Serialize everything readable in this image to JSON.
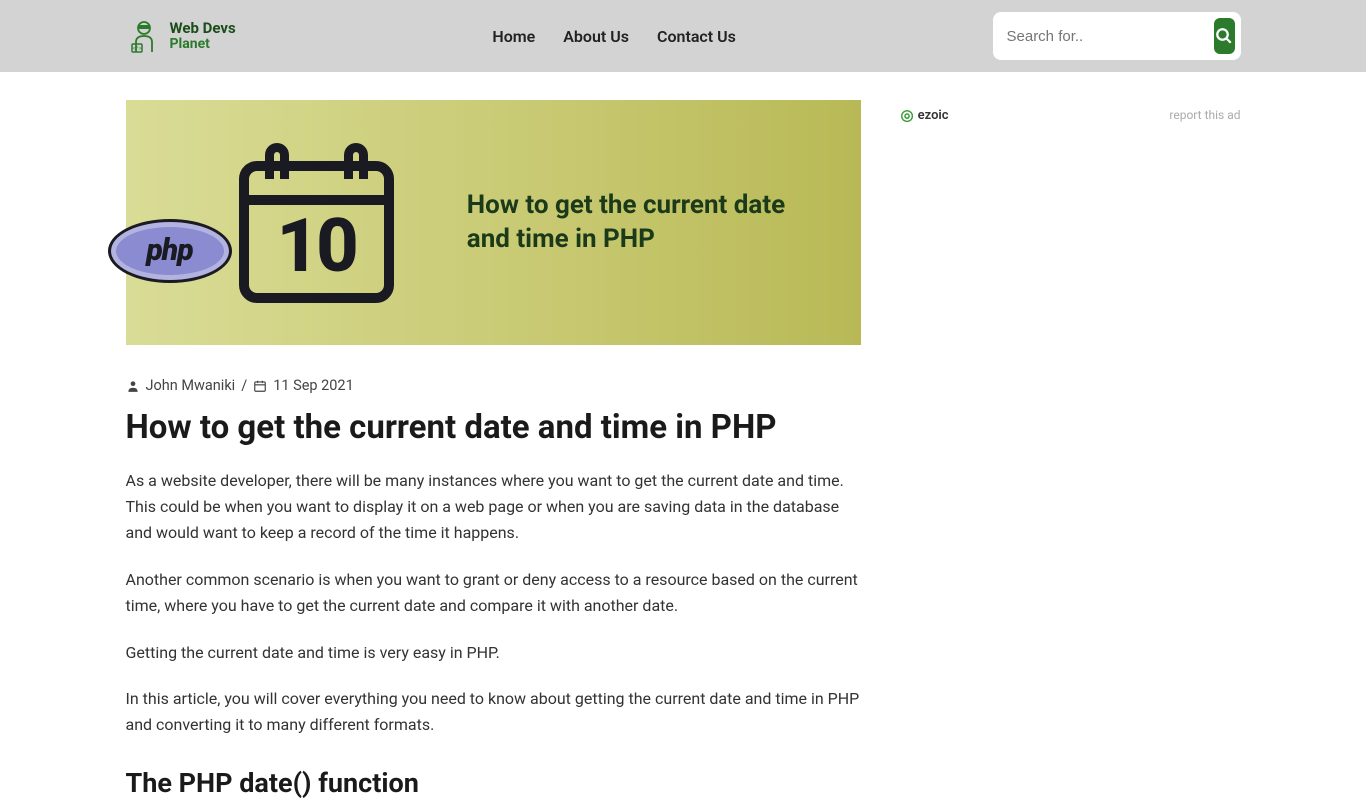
{
  "logo": {
    "line1": "Web Devs",
    "line2": "Planet"
  },
  "nav": {
    "home": "Home",
    "about": "About Us",
    "contact": "Contact Us"
  },
  "search": {
    "placeholder": "Search for.."
  },
  "hero": {
    "calendar_day": "10",
    "php_label": "php",
    "title": "How to get the current date and time in PHP"
  },
  "meta": {
    "author": "John Mwaniki",
    "separator": "/",
    "date": "11 Sep 2021"
  },
  "article": {
    "title": "How to get the current date and time in PHP",
    "p1": "As a website developer, there will be many instances where you want to get the current date and time. This could be when you want to display it on a web page or when you are saving data in the database and would want to keep a record of the time it happens.",
    "p2": "Another common scenario is when you want to grant or deny access to a resource based on the current time, where you have to get the current date and compare it with another date.",
    "p3": "Getting the current date and time is very easy in PHP.",
    "p4": "In this article, you will cover everything you need to know about getting the current date and time in PHP and converting it to many different formats.",
    "h2": "The PHP date() function"
  },
  "sidebar": {
    "ezoic": "ezoic",
    "report": "report this ad"
  }
}
